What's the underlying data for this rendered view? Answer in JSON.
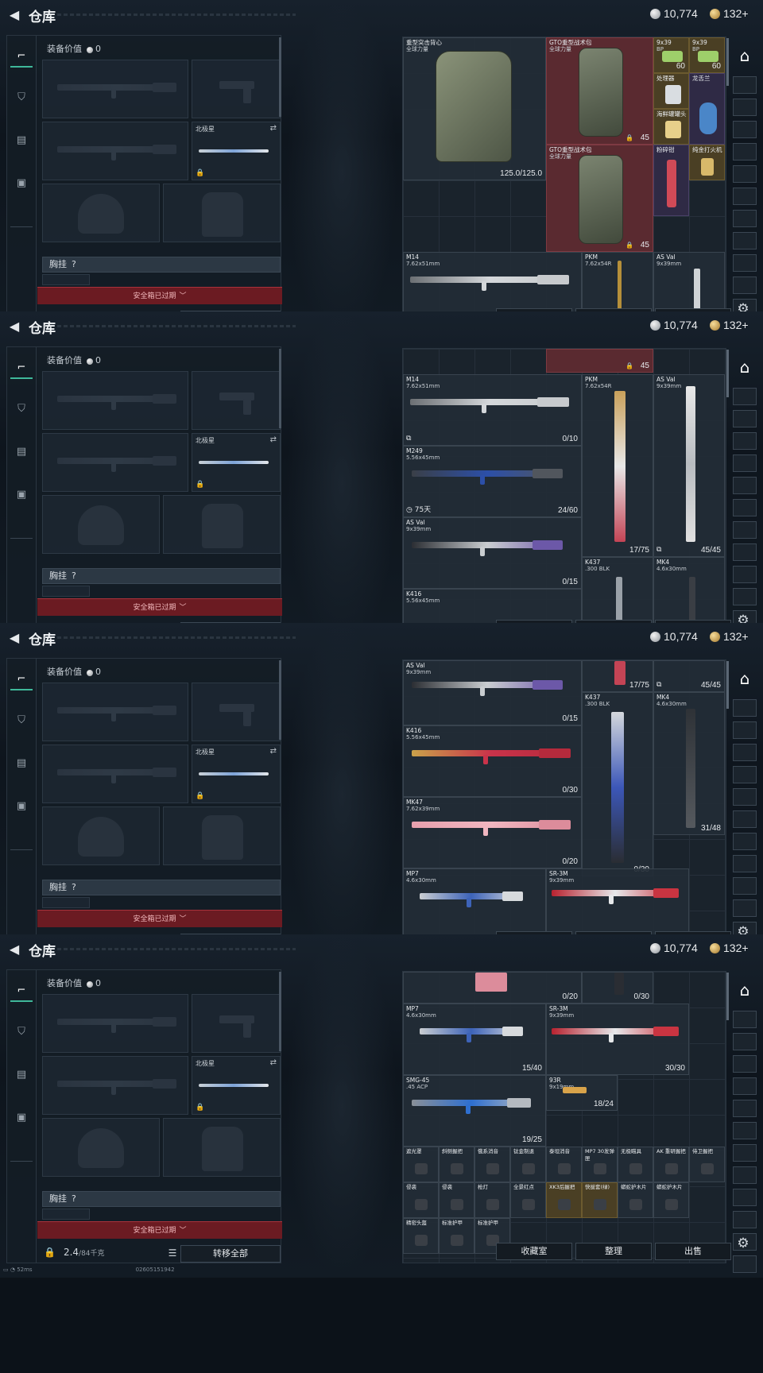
{
  "screens": [
    {
      "id": "s0",
      "right_view": "top"
    },
    {
      "id": "s1",
      "right_view": "guns1"
    },
    {
      "id": "s2",
      "right_view": "guns2"
    },
    {
      "id": "s3",
      "right_view": "guns3"
    }
  ],
  "header": {
    "back_icon": "back-arrow-icon",
    "title": "仓库",
    "silver_amount": "10,774",
    "gold_amount": "132",
    "gold_add": "+"
  },
  "left": {
    "equip_value_label": "装备价值",
    "equip_value": "0",
    "melee_label": "北极星",
    "chest_label": "胸挂",
    "chest_help": "?",
    "safe_box_expired": "安全箱已过期",
    "weight_value": "2.4",
    "weight_max": "/84千克",
    "transfer_all": "转移全部"
  },
  "status": {
    "ping": "52ms",
    "uid": "02605151942"
  },
  "right": {
    "buttons": {
      "collection": "收藏室",
      "organize": "整理",
      "sell": "出售"
    },
    "top_items": {
      "vest_name": "重型突击背心",
      "vest_sub": "全球力量",
      "vest_durability": "125.0/125.0",
      "pack1_name": "GTO重型战术包",
      "pack1_sub": "全球力量",
      "pack1_count": "45",
      "pack2_name": "GTO重型战术包",
      "pack2_sub": "全球力量",
      "pack2_count": "45",
      "ammo1": "9x39",
      "ammo1_sub": "BP",
      "ammo1_count": "60",
      "ammo2": "9x39",
      "ammo2_sub": "BP",
      "ammo2_count": "60",
      "item_a": "处理器",
      "item_b": "龙舌兰",
      "item_c": "海鲜罐罐头",
      "item_d": "粉碎钳",
      "item_e": "纯金打火机",
      "m14_name": "M14",
      "m14_cal": "7.62x51mm",
      "pkm_name": "PKM",
      "pkm_cal": "7.62x54R",
      "asval_name": "AS Val",
      "asval_cal": "9x39mm"
    },
    "guns1": {
      "m14_name": "M14",
      "m14_cal": "7.62x51mm",
      "m14_count": "0/10",
      "pkm_name": "PKM",
      "pkm_cal": "7.62x54R",
      "pkm_count": "17/75",
      "asval_name": "AS Val",
      "asval_cal": "9x39mm",
      "asval_count": "45/45",
      "m249_name": "M249",
      "m249_cal": "5.56x45mm",
      "m249_count": "24/60",
      "m249_timer": "75天",
      "asval2_name": "AS Val",
      "asval2_cal": "9x39mm",
      "asval2_count": "0/15",
      "k437_name": "K437",
      "k437_cal": ".300 BLK",
      "mk4_name": "MK4",
      "mk4_cal": "4.6x30mm",
      "k416_name": "K416",
      "k416_cal": "5.56x45mm",
      "pack_count": "45"
    },
    "guns2": {
      "asval_name": "AS Val",
      "asval_cal": "9x39mm",
      "asval_count": "0/15",
      "pkm_count": "17/75",
      "asval_top_count": "45/45",
      "k437_name": "K437",
      "k437_cal": ".300 BLK",
      "k437_count": "0/30",
      "mk4_name": "MK4",
      "mk4_cal": "4.6x30mm",
      "mk4_count": "31/48",
      "k416_name": "K416",
      "k416_cal": "5.56x45mm",
      "k416_count": "0/30",
      "mk47_name": "MK47",
      "mk47_cal": "7.62x39mm",
      "mk47_count": "0/20",
      "mp7_name": "MP7",
      "mp7_cal": "4.6x30mm",
      "sr3m_name": "SR-3M",
      "sr3m_cal": "9x39mm"
    },
    "guns3": {
      "top_count_a": "0/20",
      "top_count_b": "0/30",
      "mp7_name": "MP7",
      "mp7_cal": "4.6x30mm",
      "mp7_count": "15/40",
      "sr3m_name": "SR-3M",
      "sr3m_cal": "9x39mm",
      "sr3m_count": "30/30",
      "smg45_name": "SMG-45",
      "smg45_cal": ".45 ACP",
      "smg45_count": "19/25",
      "p93r_name": "93R",
      "p93r_cal": "9x19mm",
      "p93r_count": "18/24",
      "att_row1": [
        "遮光罩",
        "斜侧握把",
        "俄系消音",
        "钛金制退",
        "泰坦消音",
        "MP7 30发弹匣",
        "无极瞄具",
        "AK 重研握把",
        "侍卫握把"
      ],
      "att_row2": [
        "侵袭",
        "侵袭",
        "枪灯",
        "全景红点",
        "XK3后握把",
        "快拔套(绿)",
        "蟒蛇护木片",
        "蟒蛇护木片"
      ],
      "att_row3": [
        "精密头盔",
        "标准护甲",
        "标准护甲"
      ]
    }
  }
}
